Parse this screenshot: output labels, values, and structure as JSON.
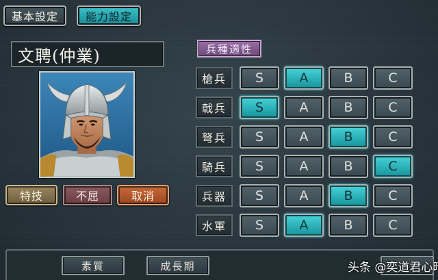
{
  "tabs": {
    "basic_settings": "基本設定",
    "ability_settings": "能力設定",
    "active": "ability_settings"
  },
  "officer": {
    "name": "文聘(仲業)"
  },
  "skill": {
    "label": "特技",
    "value": "不屈",
    "cancel": "取消"
  },
  "aptitude": {
    "title": "兵種適性",
    "grade_options": [
      "S",
      "A",
      "B",
      "C"
    ],
    "rows": [
      {
        "unit": "槍兵",
        "selected": "A"
      },
      {
        "unit": "戟兵",
        "selected": "S"
      },
      {
        "unit": "弩兵",
        "selected": "B"
      },
      {
        "unit": "騎兵",
        "selected": "C"
      },
      {
        "unit": "兵器",
        "selected": "B"
      },
      {
        "unit": "水軍",
        "selected": "A"
      }
    ]
  },
  "bottom_tabs": {
    "quality": "素質",
    "growth": "成長期"
  },
  "watermark": "头条 @奕道君心晴",
  "colors": {
    "selected_grade": "#2bb8c0",
    "tab_active": "#2aa8b0",
    "aptitude_title": "#86609a",
    "cancel_button": "#b75a2c"
  }
}
